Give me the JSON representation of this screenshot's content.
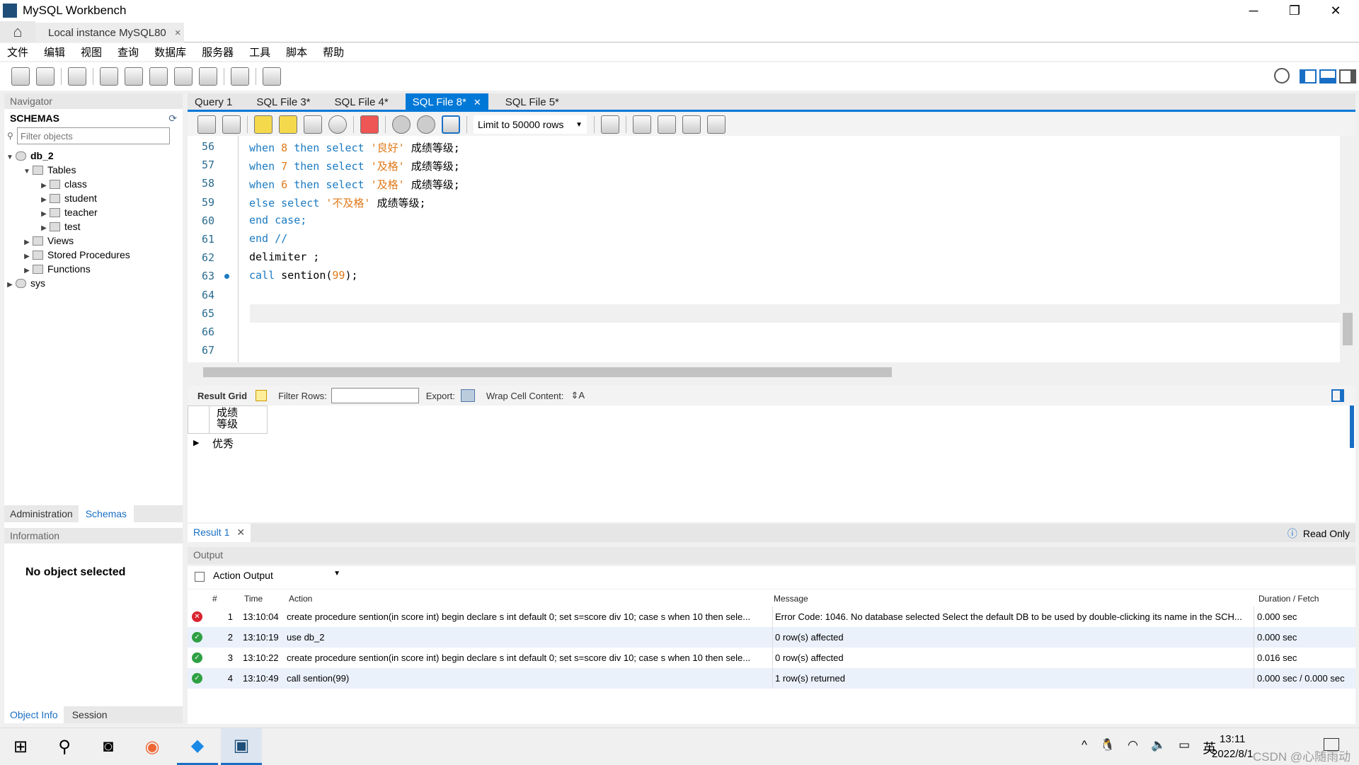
{
  "window": {
    "title": "MySQL Workbench",
    "connection_tab": "Local instance MySQL80"
  },
  "menu": [
    "文件",
    "编辑",
    "视图",
    "查询",
    "数据库",
    "服务器",
    "工具",
    "脚本",
    "帮助"
  ],
  "navigator": {
    "header": "Navigator",
    "schemas_label": "SCHEMAS",
    "filter_placeholder": "Filter objects",
    "tree": {
      "db": "db_2",
      "tables": "Tables",
      "table_items": [
        "class",
        "student",
        "teacher",
        "test"
      ],
      "views": "Views",
      "procs": "Stored Procedures",
      "funcs": "Functions",
      "sys": "sys"
    },
    "tabs": [
      "Administration",
      "Schemas"
    ],
    "info_header": "Information",
    "no_object": "No object selected",
    "bottom_tabs": [
      "Object Info",
      "Session"
    ]
  },
  "editor": {
    "tabs": [
      "Query 1",
      "SQL File 3*",
      "SQL File 4*",
      "SQL File 8*",
      "SQL File 5*"
    ],
    "active_tab": 3,
    "limit": "Limit to 50000 rows",
    "lines": [
      {
        "n": "56"
      },
      {
        "n": "57"
      },
      {
        "n": "58"
      },
      {
        "n": "59"
      },
      {
        "n": "60"
      },
      {
        "n": "61"
      },
      {
        "n": "62"
      },
      {
        "n": "63"
      },
      {
        "n": "64"
      },
      {
        "n": "65"
      },
      {
        "n": "66"
      },
      {
        "n": "67"
      }
    ],
    "code": {
      "l56": [
        "when",
        "8",
        "then select",
        "'良好'",
        "成绩等级;"
      ],
      "l57": [
        "when",
        "7",
        "then select",
        "'及格'",
        "成绩等级;"
      ],
      "l58": [
        "when",
        "6",
        "then select",
        "'及格'",
        "成绩等级;"
      ],
      "l59": [
        "else select",
        "'不及格'",
        "成绩等级;"
      ],
      "l60": "end case;",
      "l61": "end //",
      "l62": "delimiter ;",
      "l63": [
        "call",
        "sention(",
        "99",
        ");"
      ]
    }
  },
  "result": {
    "grid_label": "Result Grid",
    "filter_label": "Filter Rows:",
    "export_label": "Export:",
    "wrap_label": "Wrap Cell Content:",
    "column": "成绩\n等级",
    "value": "优秀",
    "tab": "Result 1",
    "readonly": "Read Only"
  },
  "output": {
    "header": "Output",
    "select": "Action Output",
    "columns": [
      "#",
      "Time",
      "Action",
      "Message",
      "Duration / Fetch"
    ],
    "rows": [
      {
        "status": "error",
        "n": "1",
        "time": "13:10:04",
        "action": "create procedure sention(in score int) begin  declare s int default 0; set s=score div 10; case s when 10 then sele...",
        "message": "Error Code: 1046. No database selected Select the default DB to be used by double-clicking its name in the SCH...",
        "duration": "0.000 sec"
      },
      {
        "status": "ok",
        "n": "2",
        "time": "13:10:19",
        "action": "use db_2",
        "message": "0 row(s) affected",
        "duration": "0.000 sec"
      },
      {
        "status": "ok",
        "n": "3",
        "time": "13:10:22",
        "action": "create procedure sention(in score int) begin  declare s int default 0; set s=score div 10; case s when 10 then sele...",
        "message": "0 row(s) affected",
        "duration": "0.016 sec"
      },
      {
        "status": "ok",
        "n": "4",
        "time": "13:10:49",
        "action": "call sention(99)",
        "message": "1 row(s) returned",
        "duration": "0.000 sec / 0.000 sec"
      }
    ]
  },
  "taskbar": {
    "time": "13:11",
    "date": "2022/8/1",
    "ime": "英",
    "watermark": "CSDN @心随雨动"
  },
  "colors": {
    "accent": "#0078d7",
    "keyword": "#1a7ac2",
    "string": "#e07a1a",
    "error": "#d9232e",
    "ok": "#2ea043"
  }
}
